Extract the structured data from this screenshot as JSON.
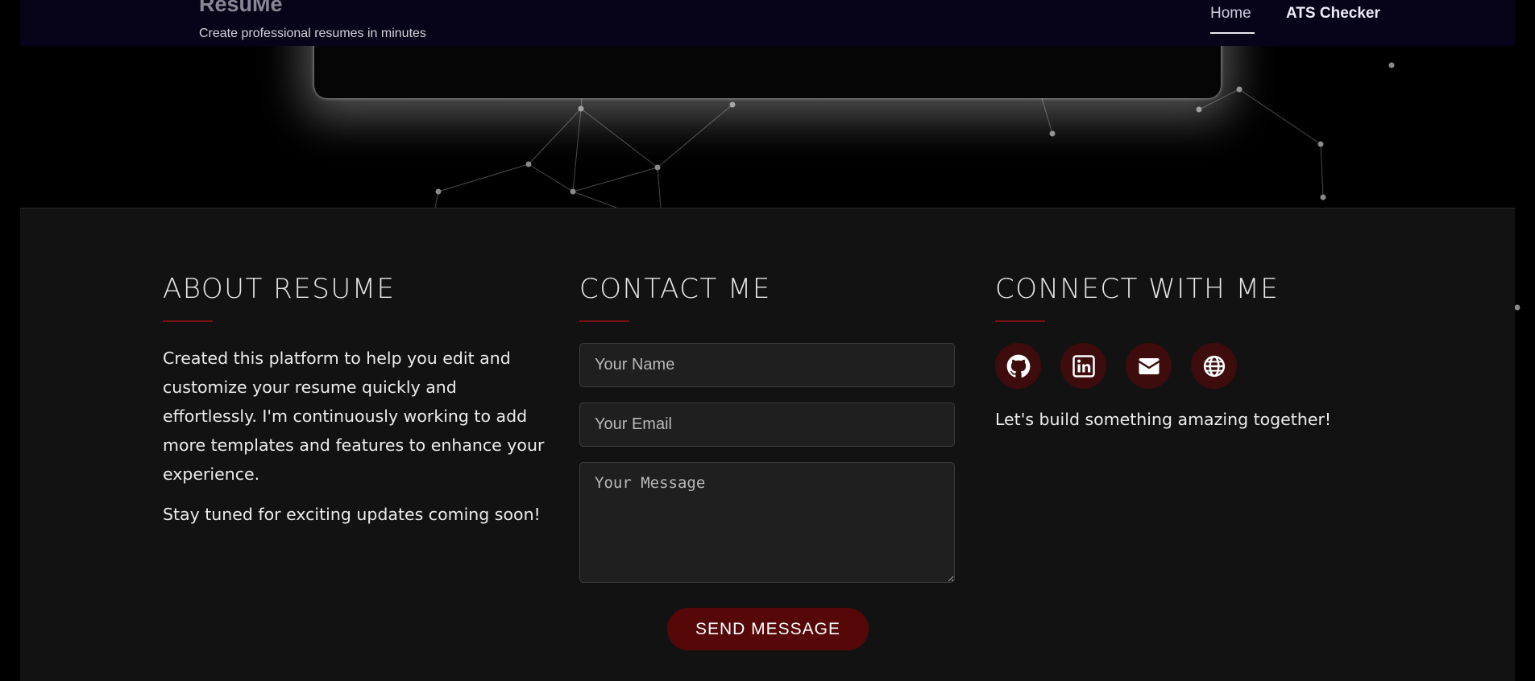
{
  "nav": {
    "brand_title": "ResuMe",
    "brand_tagline": "Create professional resumes in minutes",
    "links": [
      {
        "label": "Home"
      },
      {
        "label": "ATS Checker"
      }
    ]
  },
  "footer": {
    "about": {
      "heading": "ABOUT RESUME",
      "paragraph1": "Created this platform to help you edit and customize your resume quickly and effortlessly. I'm continuously working to add more templates and features to enhance your experience.",
      "paragraph2": "Stay tuned for exciting updates coming soon!"
    },
    "contact": {
      "heading": "CONTACT ME",
      "name_placeholder": "Your Name",
      "email_placeholder": "Your Email",
      "message_placeholder": "Your Message",
      "send_label": "SEND MESSAGE"
    },
    "connect": {
      "heading": "CONNECT WITH ME",
      "icons": [
        "github-icon",
        "linkedin-icon",
        "envelope-icon",
        "globe-icon"
      ],
      "tagline": "Let's build something amazing together!"
    }
  },
  "colors": {
    "accent": "#560808",
    "icon_bg": "#3e0c0c",
    "footer_bg": "#121212",
    "nav_bg": "#07041a"
  }
}
